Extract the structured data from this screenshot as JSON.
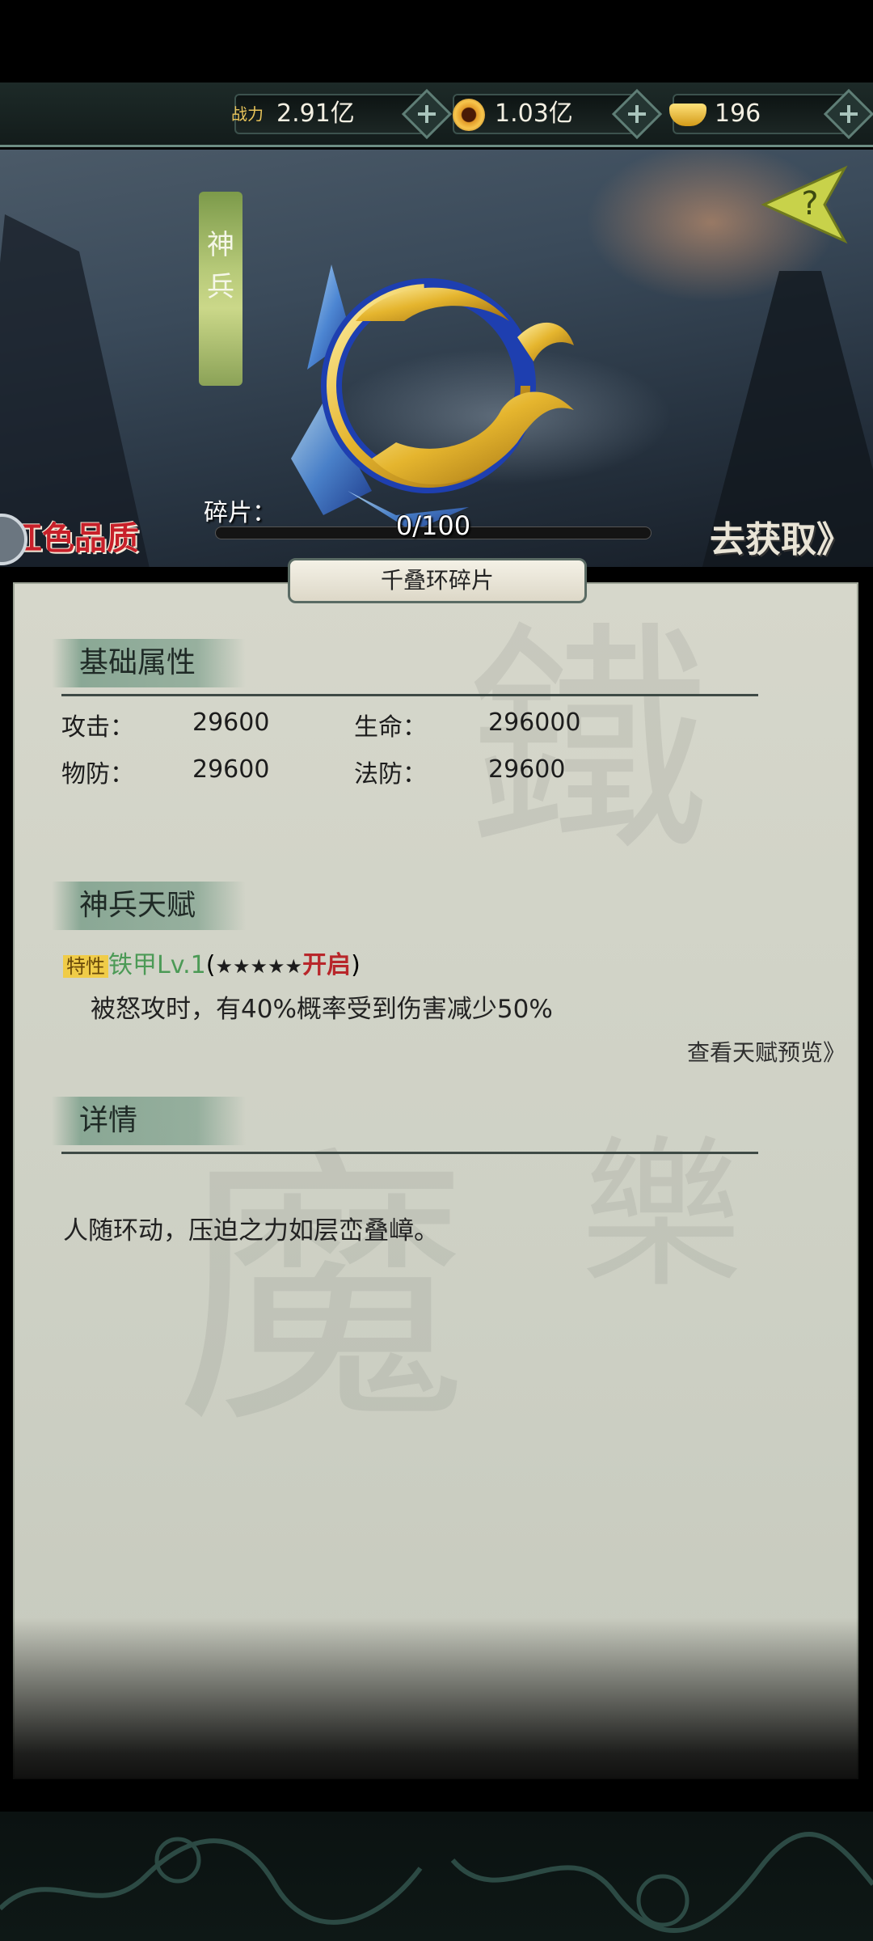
{
  "topbar": {
    "power_label": "战力",
    "power_value": "2.91亿",
    "coins_value": "1.03亿",
    "ingots_value": "196"
  },
  "banner": {
    "category": "神兵",
    "quality": "红色品质",
    "fragment_label": "碎片：",
    "fragment_progress": "0/100",
    "fragment_fraction": 0,
    "obtain_button": "去获取》"
  },
  "item": {
    "title": "千叠环碎片"
  },
  "attributes": {
    "heading": "基础属性",
    "stats": [
      {
        "label": "攻击：",
        "value": "29600"
      },
      {
        "label": "生命：",
        "value": "296000"
      },
      {
        "label": "物防：",
        "value": "29600"
      },
      {
        "label": "法防：",
        "value": "29600"
      }
    ]
  },
  "talent": {
    "heading": "神兵天赋",
    "tag": "特性",
    "name": "铁甲Lv.1",
    "open_paren": "(",
    "stars": "★★★★★",
    "unlock": "开启",
    "close_paren": ")",
    "description": "被怒攻时，有40%概率受到伤害减少50%",
    "preview_link": "查看天赋预览》"
  },
  "details": {
    "heading": "详情",
    "text": "人随环动，压迫之力如层峦叠嶂。"
  }
}
